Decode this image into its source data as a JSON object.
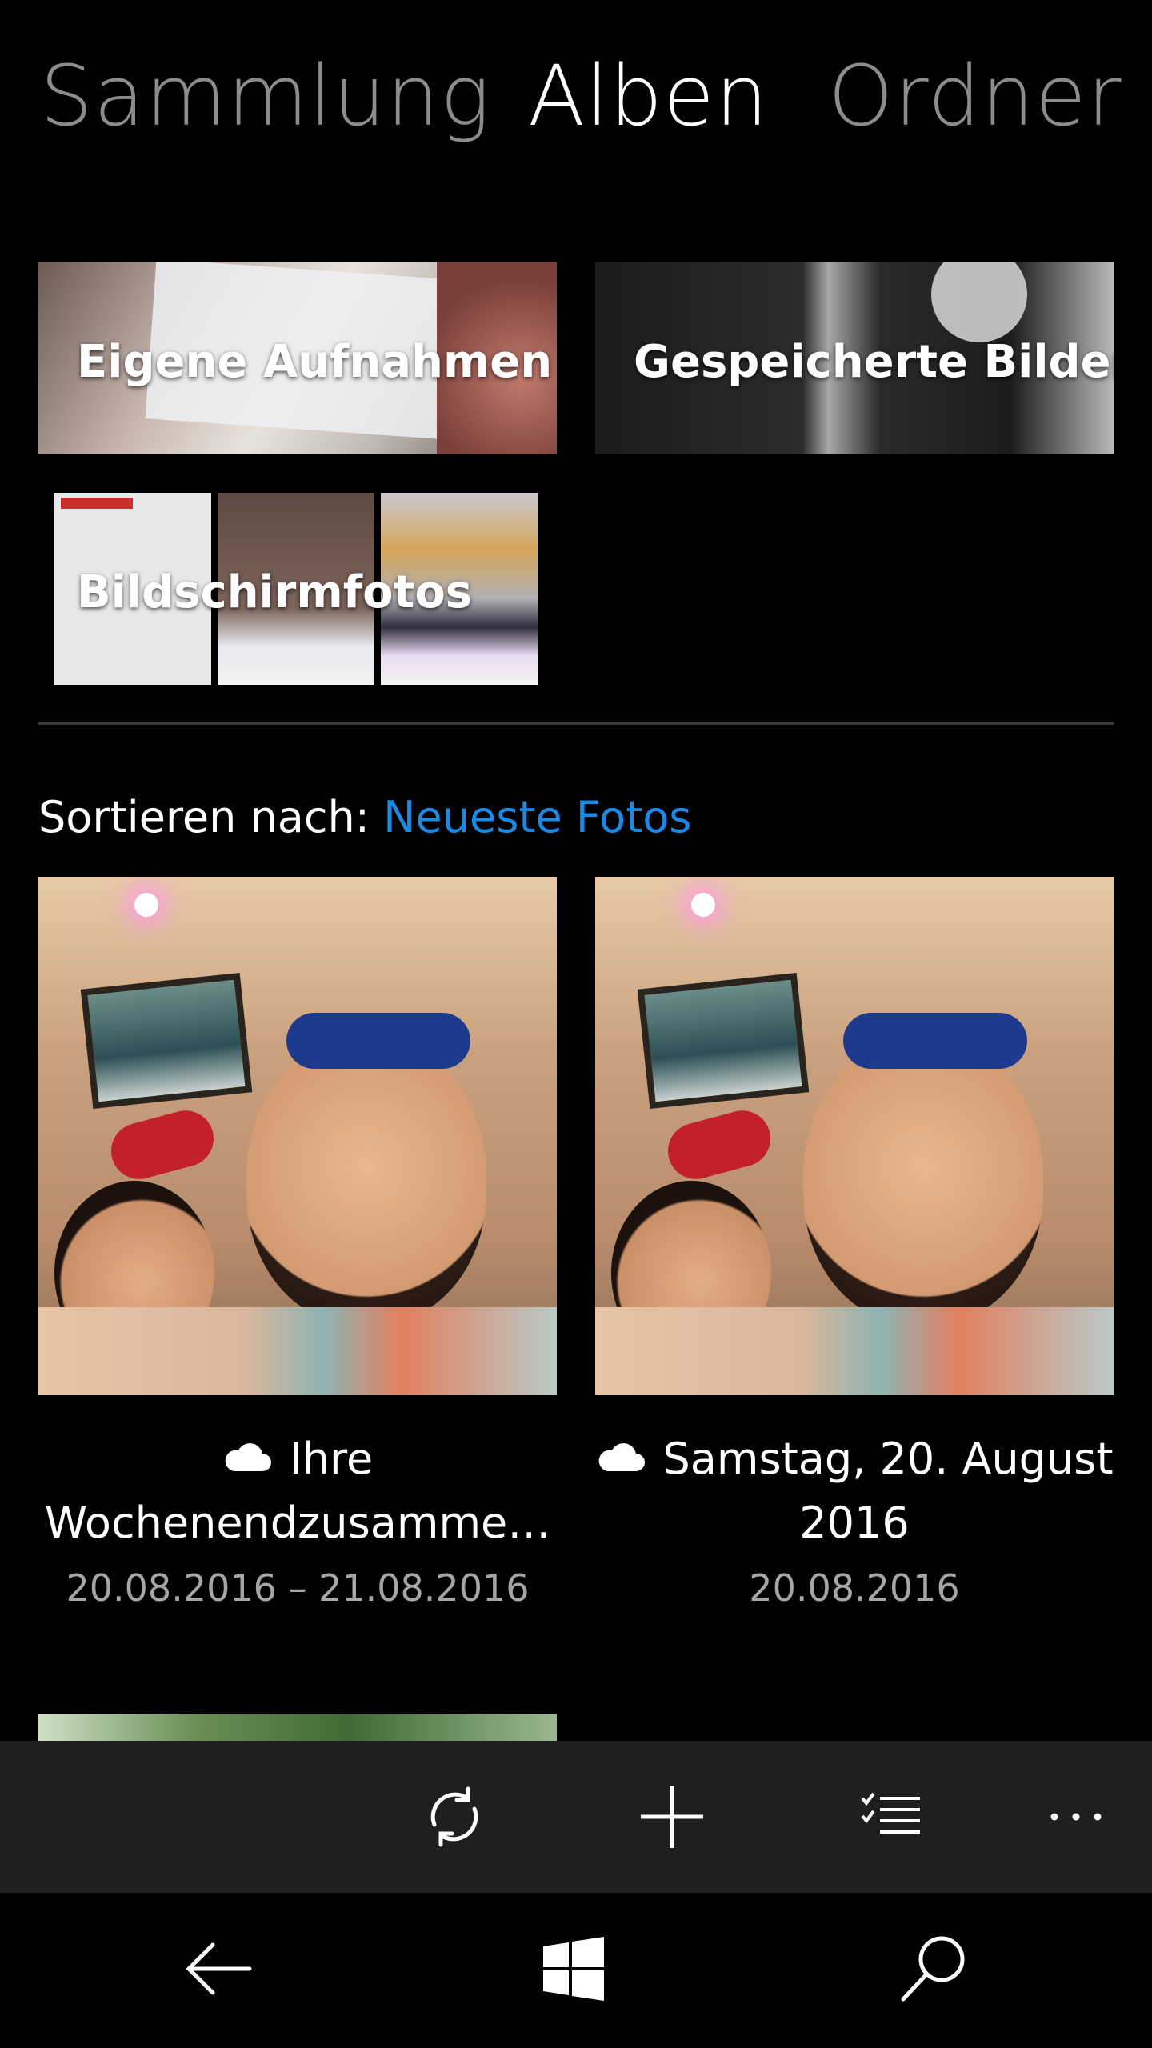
{
  "pivot": {
    "tabs": [
      {
        "label": "Sammlung",
        "active": false
      },
      {
        "label": "Alben",
        "active": true
      },
      {
        "label": "Ordner",
        "active": false
      }
    ]
  },
  "albums": {
    "tiles": [
      {
        "label": "Eigene Aufnahmen"
      },
      {
        "label": "Gespeicherte Bilder"
      },
      {
        "label": "Bildschirmfotos"
      }
    ]
  },
  "sort": {
    "prefix": "Sortieren nach:",
    "value": "Neueste Fotos"
  },
  "cards": [
    {
      "title": "Ihre Wochenendzusamme…",
      "date": "20.08.2016 – 21.08.2016",
      "icon": "cloud-icon"
    },
    {
      "title": "Samstag, 20. August 2016",
      "date": "20.08.2016",
      "icon": "cloud-icon"
    }
  ],
  "appbar": {
    "buttons": [
      {
        "icon": "sync-icon"
      },
      {
        "icon": "plus-icon"
      },
      {
        "icon": "select-list-icon"
      },
      {
        "icon": "more-icon"
      }
    ]
  },
  "navbar": {
    "buttons": [
      {
        "icon": "back-arrow-icon"
      },
      {
        "icon": "windows-start-icon"
      },
      {
        "icon": "search-icon"
      }
    ]
  },
  "colors": {
    "background": "#000000",
    "accent": "#1a8ae6",
    "appbar": "#1f1f1f",
    "inactive_tab": "#8c8c8c",
    "secondary_text": "#a6a6a6"
  }
}
